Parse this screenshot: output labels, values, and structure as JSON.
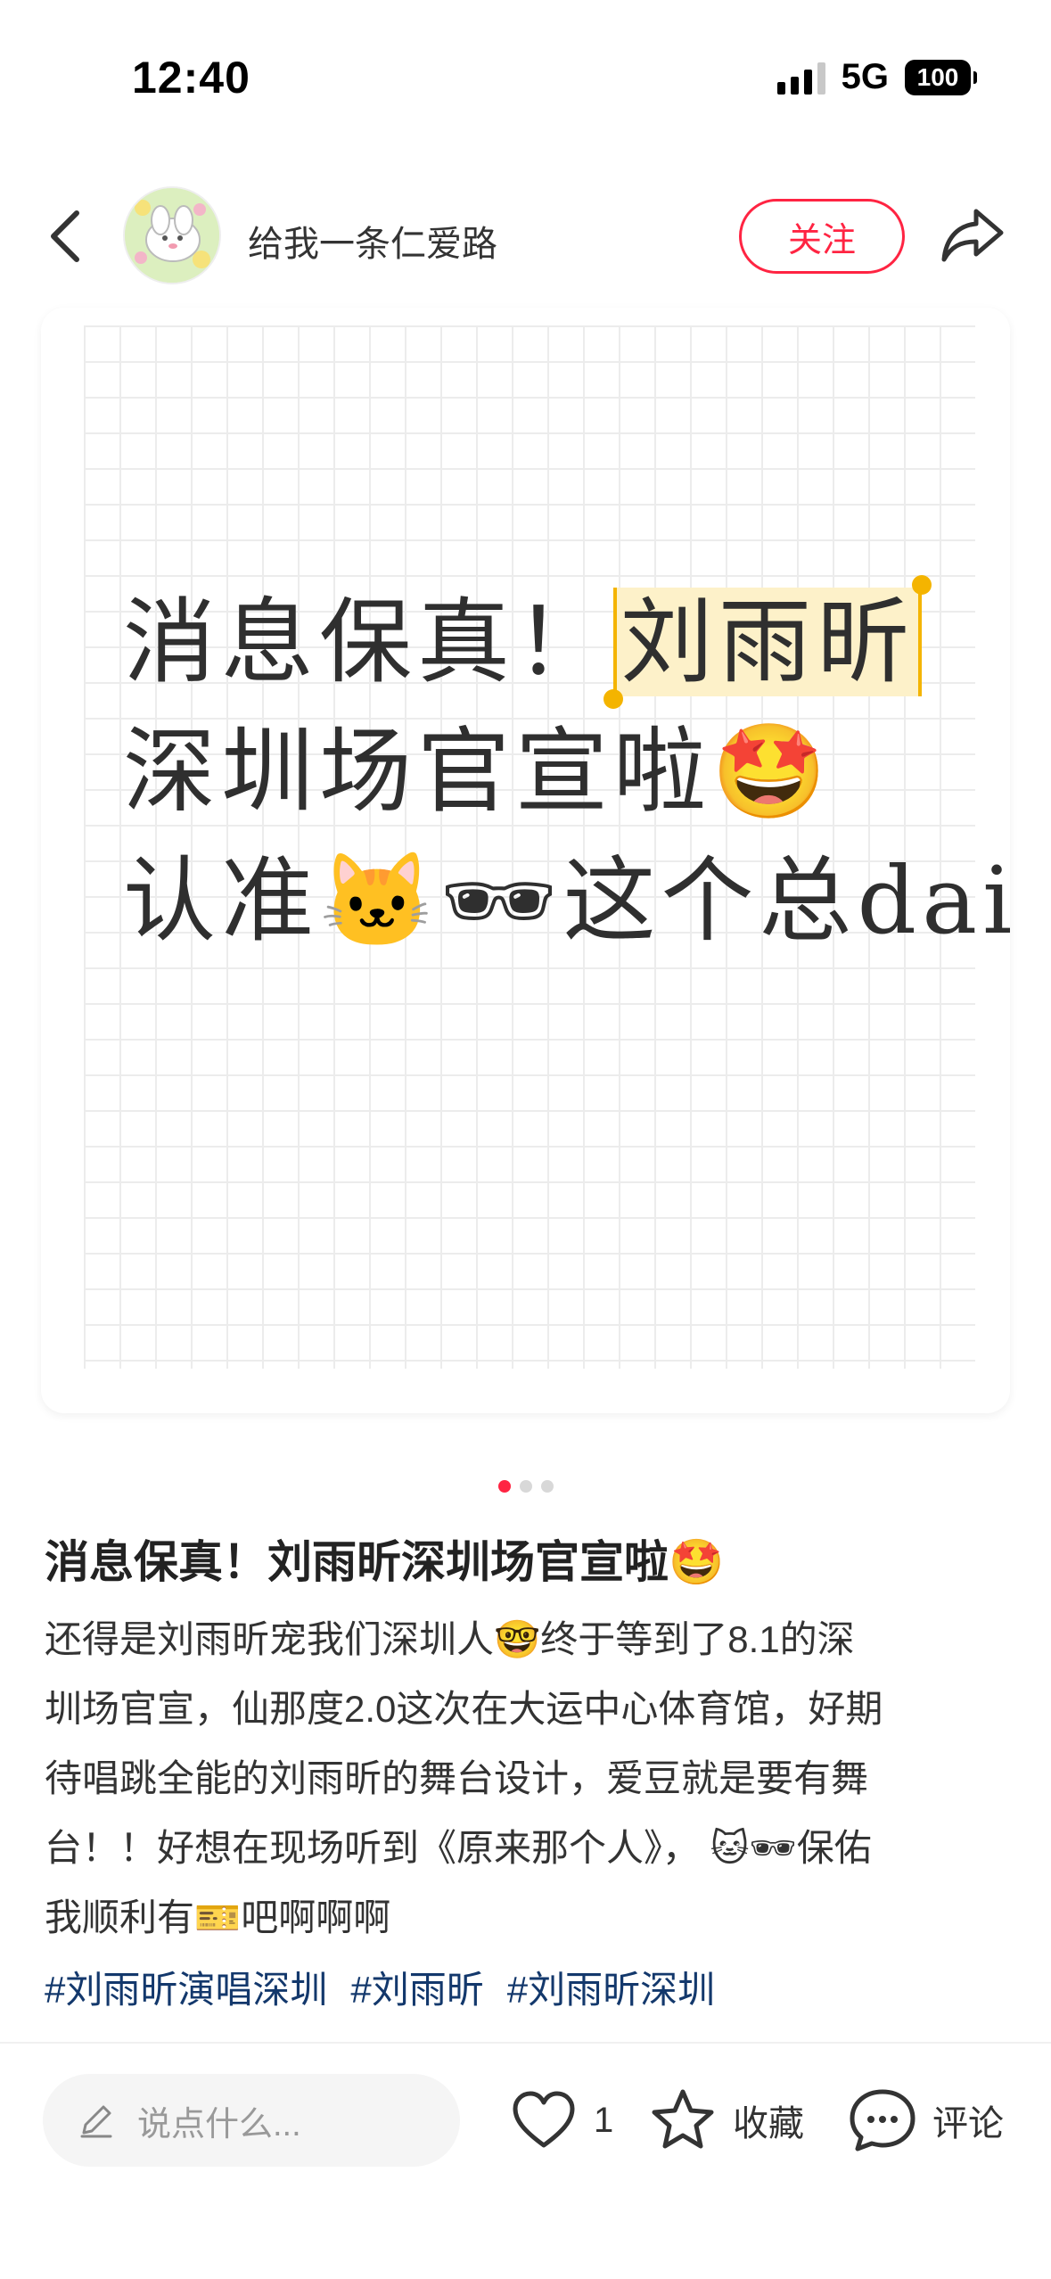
{
  "status_bar": {
    "time": "12:40",
    "network": "5G",
    "battery": "100"
  },
  "header": {
    "username": "给我一条仁爱路",
    "follow_label": "关注"
  },
  "image_card": {
    "line1_a": "消息保真！",
    "line1_b": "刘雨昕",
    "line2": "深圳场官宣啦🤩",
    "line3": "认准🐱🕶这个总dai"
  },
  "pagination": {
    "total": 3,
    "active": 1
  },
  "post": {
    "title": "消息保真！刘雨昕深圳场官宣啦🤩",
    "body_lines": [
      "还得是刘雨昕宠我们深圳人🤓终于等到了8.1的深",
      "圳场官宣，仙那度2.0这次在大运中心体育馆，好期",
      "待唱跳全能的刘雨昕的舞台设计，爱豆就是要有舞",
      "台！！好想在现场听到《原来那个人》， 🐱🕶保佑",
      "我顺利有🎫吧啊啊啊"
    ],
    "tags": [
      "#刘雨昕演唱深圳",
      "#刘雨昕",
      "#刘雨昕深圳"
    ]
  },
  "bottom_bar": {
    "comment_placeholder": "说点什么...",
    "like_count": "1",
    "collect_label": "收藏",
    "comment_label": "评论"
  }
}
